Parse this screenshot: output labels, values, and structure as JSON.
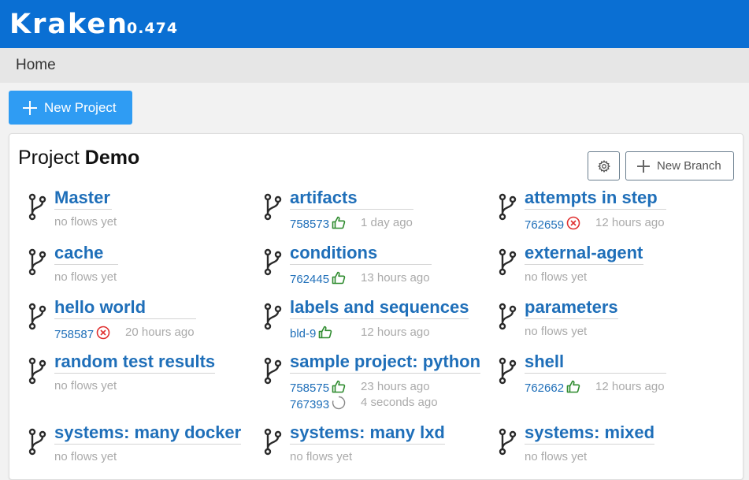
{
  "app": {
    "name": "Kraken",
    "version": "0.474"
  },
  "breadcrumb": {
    "home": "Home"
  },
  "actions": {
    "new_project": "New Project"
  },
  "project": {
    "label": "Project",
    "name": "Demo",
    "new_branch": "New Branch"
  },
  "branches": [
    {
      "name": "Master",
      "no_flows": "no flows yet"
    },
    {
      "name": "artifacts",
      "flows": [
        {
          "id": "758573",
          "status": "thumbs-up-icon",
          "ago": "1 day ago"
        }
      ]
    },
    {
      "name": "attempts in step",
      "flows": [
        {
          "id": "762659",
          "status": "error-circle-icon",
          "ago": "12 hours ago"
        }
      ]
    },
    {
      "name": "cache",
      "no_flows": "no flows yet"
    },
    {
      "name": "conditions",
      "flows": [
        {
          "id": "762445",
          "status": "thumbs-up-icon",
          "ago": "13 hours ago"
        }
      ]
    },
    {
      "name": "external-agent",
      "no_flows": "no flows yet"
    },
    {
      "name": "hello world",
      "flows": [
        {
          "id": "758587",
          "status": "error-circle-icon",
          "ago": "20 hours ago"
        }
      ]
    },
    {
      "name": "labels and sequences",
      "flows": [
        {
          "id": "bld-9",
          "status": "thumbs-up-icon",
          "ago": "12 hours ago"
        }
      ]
    },
    {
      "name": "parameters",
      "no_flows": "no flows yet"
    },
    {
      "name": "random test results",
      "no_flows": "no flows yet"
    },
    {
      "name": "sample project: python",
      "flows": [
        {
          "id": "758575",
          "status": "thumbs-up-icon",
          "ago": "23 hours ago"
        },
        {
          "id": "767393",
          "status": "spinner-icon",
          "ago": "4 seconds ago"
        }
      ]
    },
    {
      "name": "shell",
      "flows": [
        {
          "id": "762662",
          "status": "thumbs-up-icon",
          "ago": "12 hours ago"
        }
      ]
    },
    {
      "name": "systems: many docker",
      "no_flows": "no flows yet"
    },
    {
      "name": "systems: many lxd",
      "no_flows": "no flows yet"
    },
    {
      "name": "systems: mixed",
      "no_flows": "no flows yet"
    }
  ],
  "colors": {
    "header": "#0a6fd3",
    "primary_button": "#2f9cf3",
    "link": "#1f6fb9",
    "success": "#2e8b2e",
    "error": "#e03030"
  }
}
